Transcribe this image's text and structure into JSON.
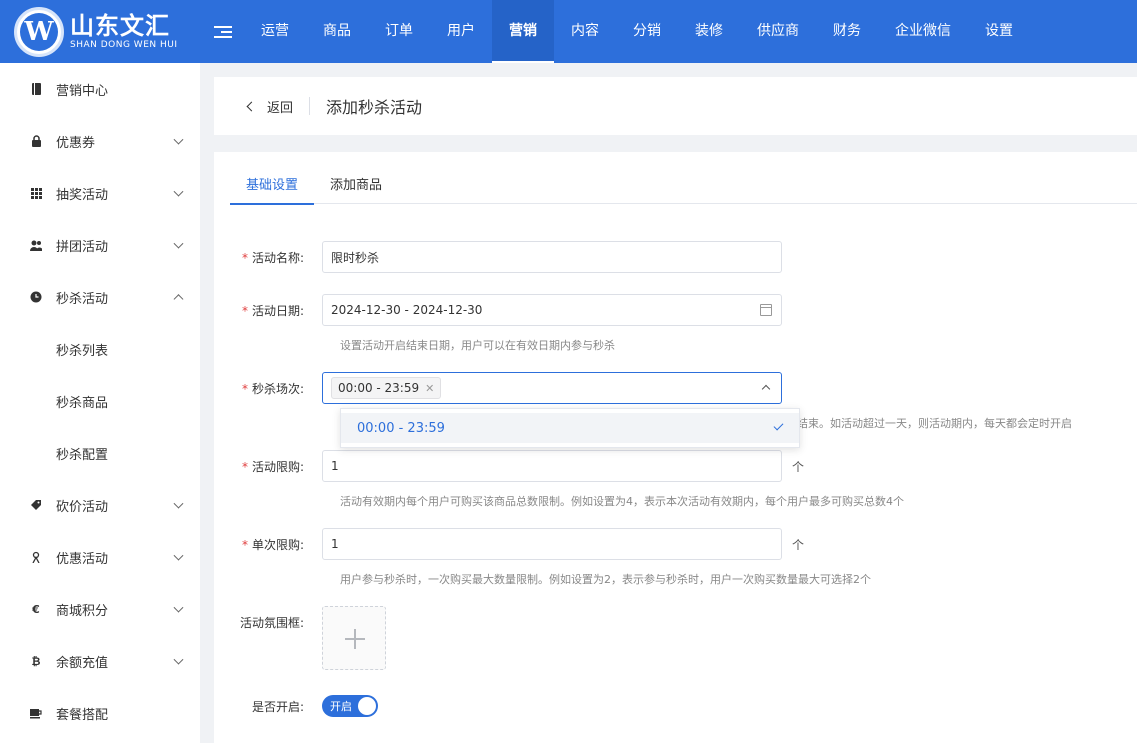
{
  "brand": {
    "name_cn": "山东文汇",
    "name_en": "SHAN DONG WEN HUI",
    "mark": "W",
    "color": "#2d6fdb"
  },
  "nav": [
    {
      "label": "运营",
      "active": false
    },
    {
      "label": "商品",
      "active": false
    },
    {
      "label": "订单",
      "active": false
    },
    {
      "label": "用户",
      "active": false
    },
    {
      "label": "营销",
      "active": true
    },
    {
      "label": "内容",
      "active": false
    },
    {
      "label": "分销",
      "active": false
    },
    {
      "label": "装修",
      "active": false
    },
    {
      "label": "供应商",
      "active": false
    },
    {
      "label": "财务",
      "active": false
    },
    {
      "label": "企业微信",
      "active": false
    },
    {
      "label": "设置",
      "active": false
    }
  ],
  "sidebar": {
    "items": [
      {
        "label": "营销中心",
        "icon": "book-icon"
      },
      {
        "label": "优惠券",
        "icon": "lock-icon"
      },
      {
        "label": "抽奖活动",
        "icon": "grid-icon"
      },
      {
        "label": "拼团活动",
        "icon": "group-icon"
      },
      {
        "label": "秒杀活动",
        "icon": "clock-icon"
      },
      {
        "label": "砍价活动",
        "icon": "tag-icon"
      },
      {
        "label": "优惠活动",
        "icon": "gift-icon"
      },
      {
        "label": "商城积分",
        "icon": "euro-icon"
      },
      {
        "label": "余额充值",
        "icon": "bitcoin-icon"
      },
      {
        "label": "套餐搭配",
        "icon": "cup-icon"
      }
    ],
    "sub_items": [
      "秒杀列表",
      "秒杀商品",
      "秒杀配置"
    ]
  },
  "header": {
    "back_label": "返回",
    "title": "添加秒杀活动"
  },
  "tabs": [
    "基础设置",
    "添加商品"
  ],
  "form": {
    "name": {
      "label": "活动名称:",
      "value": "限时秒杀"
    },
    "date": {
      "label": "活动日期:",
      "value": "2024-12-30 - 2024-12-30",
      "help": "设置活动开启结束日期，用户可以在有效日期内参与秒杀"
    },
    "session": {
      "label": "秒杀场次:",
      "tag": "00:00 - 23:59",
      "help_tail": "结束。如活动超过一天，则活动期内，每天都会定时开启",
      "option": "00:00 - 23:59"
    },
    "total_limit": {
      "label": "活动限购:",
      "value": "1",
      "unit": "个",
      "help": "活动有效期内每个用户可购买该商品总数限制。例如设置为4，表示本次活动有效期内，每个用户最多可购买总数4个"
    },
    "single_limit": {
      "label": "单次限购:",
      "value": "1",
      "unit": "个",
      "help": "用户参与秒杀时，一次购买最大数量限制。例如设置为2，表示参与秒杀时，用户一次购买数量最大可选择2个"
    },
    "frame": {
      "label": "活动氛围框:"
    },
    "enabled": {
      "label": "是否开启:",
      "switch_label": "开启"
    }
  }
}
